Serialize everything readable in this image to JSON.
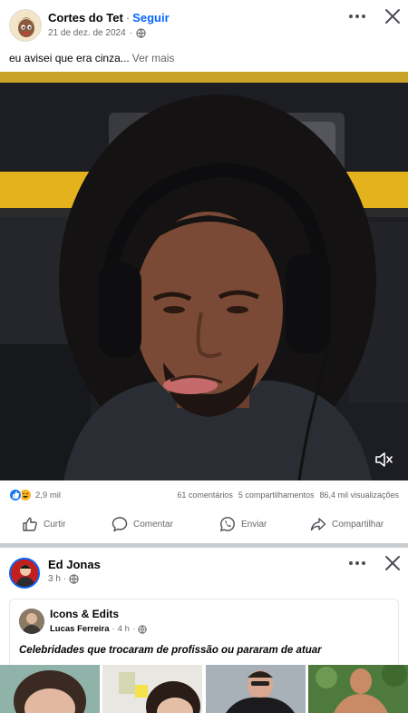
{
  "post1": {
    "author": "Cortes do Tet",
    "separator": "·",
    "follow_label": "Seguir",
    "date": "21 de dez. de 2024",
    "caption": "eu avisei que era cinza...",
    "see_more": "Ver mais",
    "stats": {
      "reactions_count": "2,9 mil",
      "comments": "61 comentários",
      "shares": "5 compartilhamentos",
      "views": "86,4 mil visualizações"
    },
    "actions": {
      "like": "Curtir",
      "comment": "Comentar",
      "send": "Enviar",
      "share": "Compartilhar"
    }
  },
  "post2": {
    "author": "Ed Jonas",
    "time": "3 h",
    "separator": "·",
    "shared": {
      "page_name": "Icons & Edits",
      "author": "Lucas Ferreira",
      "time": "4 h",
      "text": "Celebridades que trocaram de profissão ou pararam de atuar"
    }
  },
  "icons": {
    "more": "more-icon",
    "close": "close-icon",
    "globe": "globe-icon",
    "mute": "mute-icon",
    "like": "like-icon",
    "comment": "comment-icon",
    "whatsapp": "whatsapp-icon",
    "share": "share-icon"
  },
  "colors": {
    "accent": "#0866ff",
    "muted_text": "#65676b",
    "like_reaction": "#1877f2",
    "haha_reaction": "#f7b125",
    "divider": "#c9ccd1"
  }
}
